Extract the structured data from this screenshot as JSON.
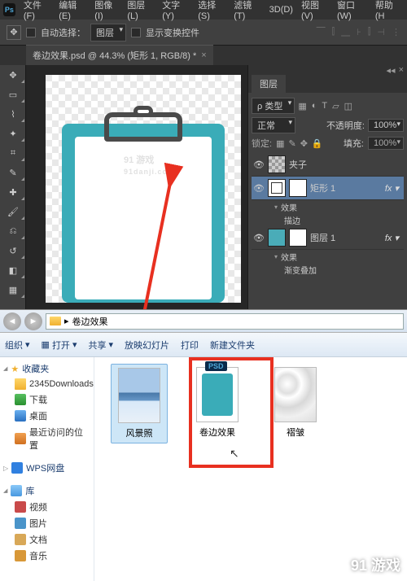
{
  "ps": {
    "menu": [
      "文件(F)",
      "编辑(E)",
      "图像(I)",
      "图层(L)",
      "文字(Y)",
      "选择(S)",
      "滤镜(T)",
      "3D(D)",
      "视图(V)",
      "窗口(W)",
      "帮助(H"
    ],
    "options": {
      "auto_select": "自动选择：",
      "target_dd": "图层",
      "show_transform": "显示变换控件"
    },
    "tab": "卷边效果.psd @ 44.3% (矩形 1, RGB/8) *",
    "panel": {
      "title": "图层",
      "type_label": "ρ 类型",
      "blend": "正常",
      "opacity_label": "不透明度:",
      "opacity_val": "100%",
      "lock_label": "锁定:",
      "fill_label": "填充:",
      "fill_val": "100%",
      "layers": [
        {
          "name": "夹子",
          "fx": false
        },
        {
          "name": "矩形 1",
          "fx": true,
          "effects": [
            "效果",
            "描边"
          ]
        },
        {
          "name": "图层 1",
          "fx": true,
          "effects": [
            "效果",
            "渐变叠加"
          ]
        }
      ]
    },
    "watermark_main": "91 游戏",
    "watermark_sub": "91danji.com"
  },
  "explorer": {
    "path": "卷边效果",
    "cmds": {
      "organize": "组织",
      "open": "打开",
      "share": "共享",
      "slideshow": "放映幻灯片",
      "print": "打印",
      "new_folder": "新建文件夹"
    },
    "nav": {
      "favorites": "收藏夹",
      "fav_items": [
        "2345Downloads",
        "下载",
        "桌面",
        "最近访问的位置"
      ],
      "wps": "WPS网盘",
      "lib": "库",
      "lib_items": [
        "视频",
        "图片",
        "文档",
        "音乐"
      ]
    },
    "files": [
      {
        "name": "风景照",
        "type": "landscape",
        "selected": true
      },
      {
        "name": "卷边效果",
        "type": "psd"
      },
      {
        "name": "褶皱",
        "type": "paper"
      }
    ]
  },
  "corner_wm": "91 游戏"
}
